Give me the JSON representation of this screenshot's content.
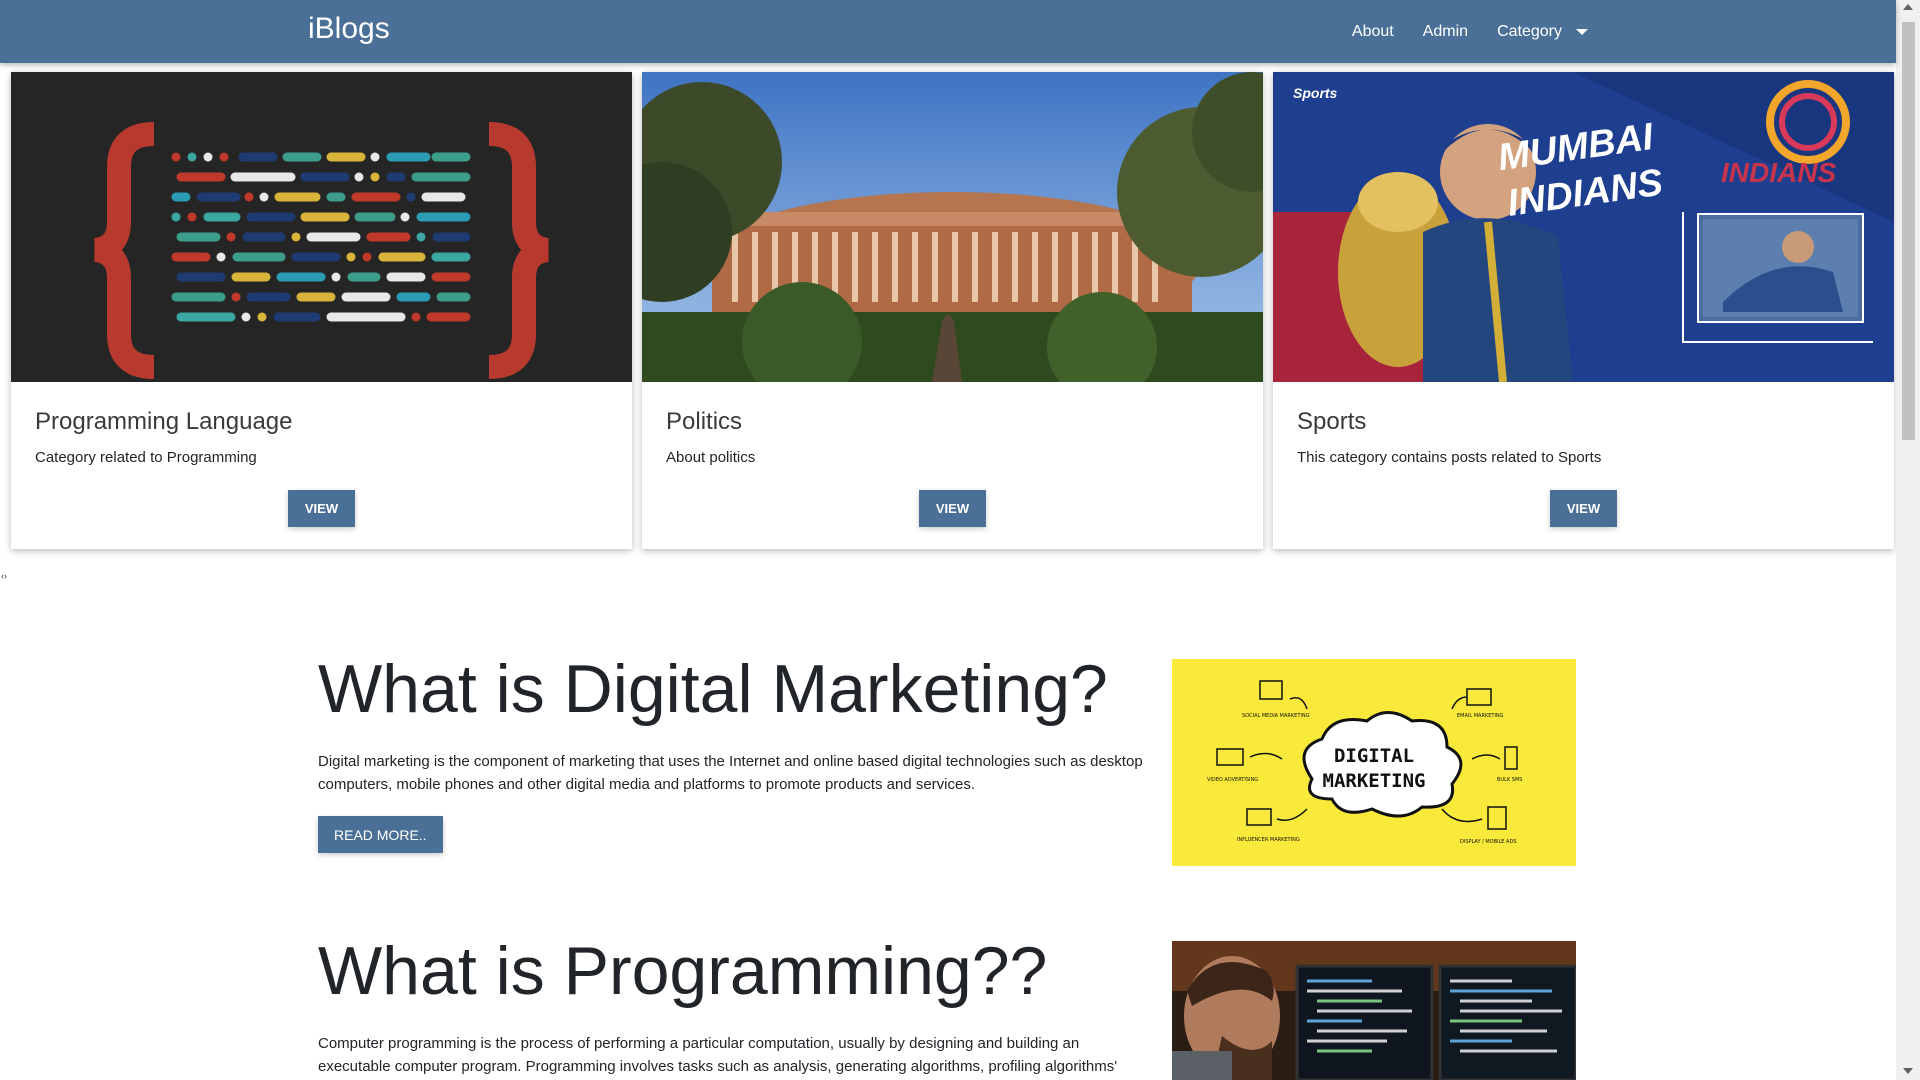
{
  "navbar": {
    "brand": "iBlogs",
    "links": [
      "About",
      "Admin",
      "Category"
    ]
  },
  "categories": [
    {
      "title": "Programming Language",
      "description": "Category related to Programming",
      "button": "VIEW",
      "image": "code-braces-illustration"
    },
    {
      "title": "Politics",
      "description": "About politics",
      "button": "VIEW",
      "image": "parliament-building-photo"
    },
    {
      "title": "Sports",
      "description": "This category contains posts related to Sports",
      "button": "VIEW",
      "image": "cricket-team-banner-photo"
    }
  ],
  "sports_banner": {
    "source_logo": "Sports",
    "headline_line1": "MUMBAI",
    "headline_line2": "INDIANS",
    "team_logo": "INDIANS"
  },
  "marker": "‹›",
  "articles": [
    {
      "title": "What is Digital Marketing?",
      "text": "Digital marketing is the component of marketing that uses the Internet and online based digital technologies such as desktop computers, mobile phones and other digital media and platforms to promote products and services.",
      "button": "READ MORE..",
      "image": "digital-marketing-diagram",
      "image_labels": {
        "center_line1": "DIGITAL",
        "center_line2": "MARKETING",
        "items": [
          "SOCIAL MEDIA MARKETING",
          "EMAIL MARKETING",
          "VIDEO ADVERTISING",
          "BULK SMS",
          "INFLUENCER MARKETING",
          "DISPLAY / MOBILE ADS"
        ]
      }
    },
    {
      "title": "What is Programming??",
      "text": "Computer programming is the process of performing a particular computation, usually by designing and building an executable computer program. Programming involves tasks such as analysis, generating algorithms, profiling algorithms'",
      "image": "programmer-at-monitors-photo"
    }
  ],
  "colors": {
    "primary": "#4b7098",
    "text": "#212529",
    "marketing_bg": "#f9e93a"
  }
}
